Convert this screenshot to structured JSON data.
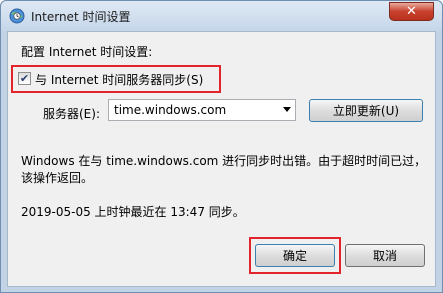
{
  "window": {
    "title": "Internet 时间设置"
  },
  "form": {
    "heading": "配置 Internet 时间设置:",
    "sync_checkbox_label": "与 Internet 时间服务器同步(S)",
    "sync_checked": true,
    "server_label": "服务器(E):",
    "server_value": "time.windows.com",
    "update_button": "立即更新(U)"
  },
  "status": {
    "line1": "Windows 在与 time.windows.com 进行同步时出错。由于超时时间已过，",
    "line2": "该操作返回。",
    "last_sync": "2019-05-05 上时钟最近在 13:47 同步。"
  },
  "buttons": {
    "ok": "确定",
    "cancel": "取消"
  },
  "icons": {
    "title": "clock-globe-icon",
    "close": "close-icon",
    "check": "checkmark-icon",
    "dropdown": "chevron-down-icon"
  }
}
